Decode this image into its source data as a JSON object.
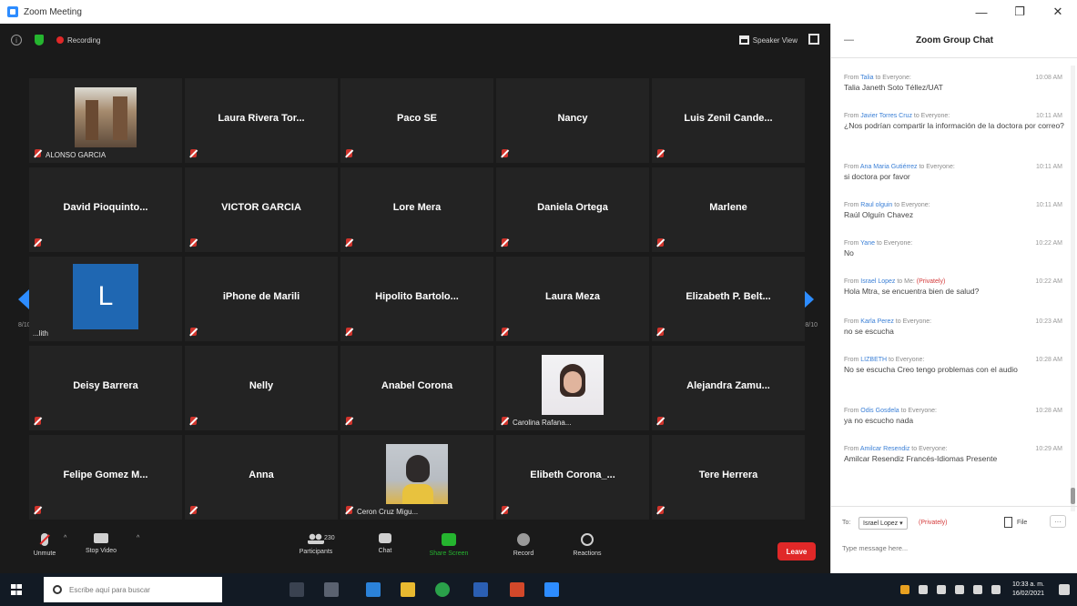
{
  "window": {
    "title": "Zoom Meeting",
    "controls": [
      "—",
      "❐",
      "✕"
    ]
  },
  "meeting_bar": {
    "recording_label": "Recording",
    "speaker_view_label": "Speaker View"
  },
  "participants_grid": {
    "rows": [
      [
        {
          "name": "",
          "caption": "ALONSO GARCIA",
          "photo": "alonso"
        },
        {
          "name": "Laura Rivera Tor...",
          "caption": ""
        },
        {
          "name": "Paco SE",
          "caption": ""
        },
        {
          "name": "Nancy",
          "caption": ""
        },
        {
          "name": "Luis Zenil Cande...",
          "caption": ""
        }
      ],
      [
        {
          "name": "David Pioquinto...",
          "caption": ""
        },
        {
          "name": "VICTOR GARCIA",
          "caption": ""
        },
        {
          "name": "Lore Mera",
          "caption": ""
        },
        {
          "name": "Daniela Ortega",
          "caption": ""
        },
        {
          "name": "Marlene",
          "caption": ""
        }
      ],
      [
        {
          "name": "",
          "caption": "...lith",
          "avatar_letter": "L"
        },
        {
          "name": "iPhone de Marili",
          "caption": ""
        },
        {
          "name": "Hipolito Bartolo...",
          "caption": ""
        },
        {
          "name": "Laura Meza",
          "caption": ""
        },
        {
          "name": "Elizabeth P. Belt...",
          "caption": ""
        }
      ],
      [
        {
          "name": "Deisy Barrera",
          "caption": ""
        },
        {
          "name": "Nelly",
          "caption": ""
        },
        {
          "name": "Anabel Corona",
          "caption": ""
        },
        {
          "name": "",
          "caption": "Carolina Rafana...",
          "photo": "carolina"
        },
        {
          "name": "Alejandra Zamu...",
          "caption": ""
        }
      ],
      [
        {
          "name": "Felipe Gomez M...",
          "caption": ""
        },
        {
          "name": "Anna",
          "caption": ""
        },
        {
          "name": "",
          "caption": "Ceron Cruz Migu...",
          "photo": "ceron"
        },
        {
          "name": "Elibeth Corona_...",
          "caption": ""
        },
        {
          "name": "Tere Herrera",
          "caption": ""
        }
      ]
    ],
    "page_left": "8/10",
    "page_right": "8/10"
  },
  "toolbar": {
    "unmute": "Unmute",
    "stop_video": "Stop Video",
    "participants": "Participants",
    "participant_count": "230",
    "chat": "Chat",
    "share_screen": "Share Screen",
    "record": "Record",
    "reactions": "Reactions",
    "leave": "Leave"
  },
  "chat": {
    "title": "Zoom Group Chat",
    "messages": [
      {
        "from_prefix": "From ",
        "sender": "Talia",
        "to": " to Everyone:",
        "private": "",
        "time": "10:08 AM",
        "text": "Talia Janeth Soto Téllez/UAT"
      },
      {
        "from_prefix": "From ",
        "sender": "Javier Torres Cruz",
        "to": " to Everyone:",
        "private": "",
        "time": "10:11 AM",
        "text": "¿Nos podrían compartir la información de la doctora por correo?"
      },
      {
        "from_prefix": "From ",
        "sender": "Ana Maria Gutiérrez",
        "to": " to Everyone:",
        "private": "",
        "time": "10:11 AM",
        "text": "si doctora por favor"
      },
      {
        "from_prefix": "From ",
        "sender": "Raul olguin",
        "to": " to Everyone:",
        "private": "",
        "time": "10:11 AM",
        "text": "Raúl Olguín Chavez"
      },
      {
        "from_prefix": "From ",
        "sender": "Yane",
        "to": " to Everyone:",
        "private": "",
        "time": "10:22 AM",
        "text": "No"
      },
      {
        "from_prefix": "From ",
        "sender": "Israel Lopez",
        "to": " to Me:",
        "private": " (Privately)",
        "time": "10:22 AM",
        "text": "Hola Mtra, se encuentra bien de salud?"
      },
      {
        "from_prefix": "From ",
        "sender": "Karla Perez",
        "to": " to Everyone:",
        "private": "",
        "time": "10:23 AM",
        "text": "no se escucha"
      },
      {
        "from_prefix": "From ",
        "sender": "LIZBETH",
        "to": " to Everyone:",
        "private": "",
        "time": "10:28 AM",
        "text": "No se escucha Creo tengo problemas con el audio"
      },
      {
        "from_prefix": "From ",
        "sender": "Odis Gosdela",
        "to": " to Everyone:",
        "private": "",
        "time": "10:28 AM",
        "text": "ya no escucho nada"
      },
      {
        "from_prefix": "From ",
        "sender": "Amilcar Resendiz",
        "to": " to Everyone:",
        "private": "",
        "time": "10:29 AM",
        "text": "Amilcar Resendiz Francés-Idiomas Presente"
      }
    ],
    "to_label": "To:",
    "to_value": "Israel Lopez ▾",
    "to_private": "(Privately)",
    "file_label": "File",
    "more_label": "···",
    "input_placeholder": "Type message here..."
  },
  "taskbar": {
    "search_placeholder": "Escribe aquí para buscar",
    "time": "10:33 a. m.",
    "date": "16/02/2021"
  }
}
